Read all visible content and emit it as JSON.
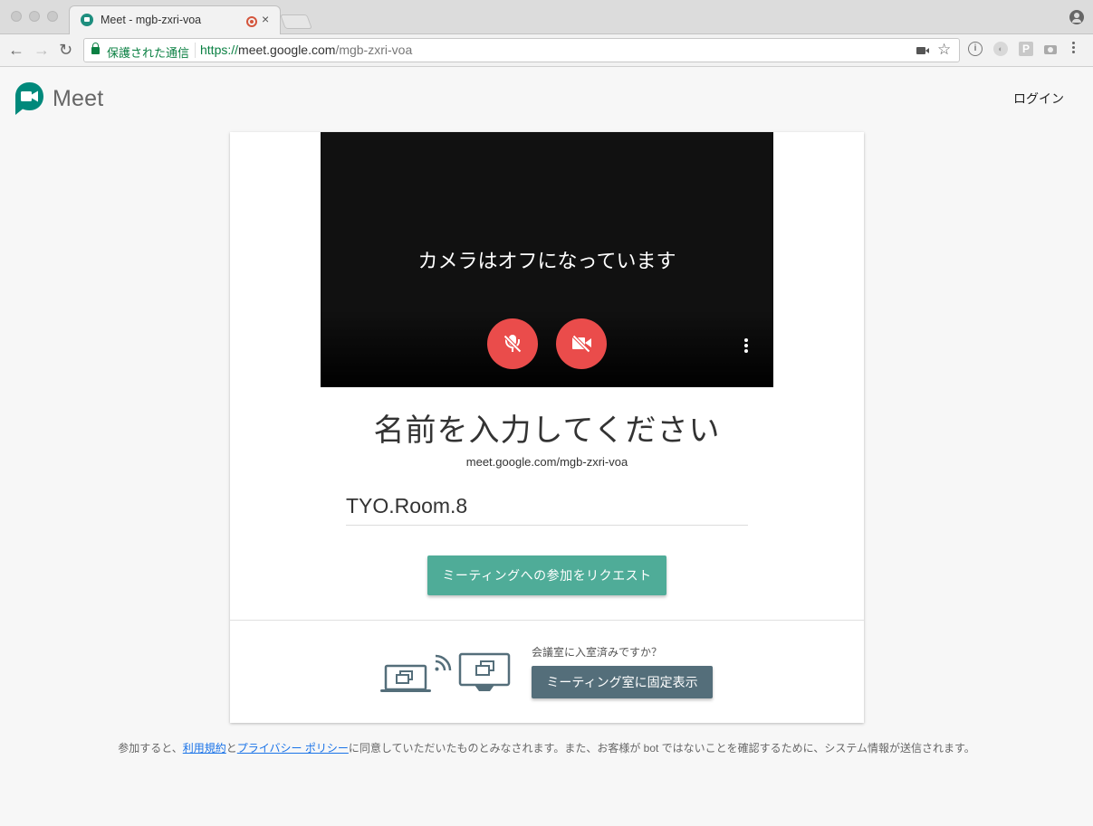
{
  "browser": {
    "tab_title": "Meet - mgb-zxri-voa",
    "tab_close": "×",
    "security_label": "保護された通信",
    "url_scheme": "https://",
    "url_host": "meet.google.com",
    "url_path": "/mgb-zxri-voa",
    "extension_p": "P",
    "extension_info": "i"
  },
  "header": {
    "logo_text": "Meet",
    "login_label": "ログイン"
  },
  "preview": {
    "camera_off_message": "カメラはオフになっています"
  },
  "join": {
    "title": "名前を入力してください",
    "meeting_url": "meet.google.com/mgb-zxri-voa",
    "name_value": "TYO.Room.8",
    "request_button_label": "ミーティングへの参加をリクエスト"
  },
  "room": {
    "question": "会議室に入室済みですか？",
    "present_button_label": "ミーティング室に固定表示"
  },
  "footer": {
    "text_before": "参加すると、",
    "terms_link": "利用規約",
    "text_and": "と",
    "privacy_link": "プライバシー ポリシー",
    "text_after": "に同意していただいたものとみなされます。また、お客様が bot ではないことを確認するために、システム情報が送信されます。"
  },
  "colors": {
    "meet_green": "#00897b",
    "request_button": "#4fac98",
    "control_red": "#ea4c4b",
    "present_button": "#546e7a",
    "link_blue": "#1a73e8"
  }
}
